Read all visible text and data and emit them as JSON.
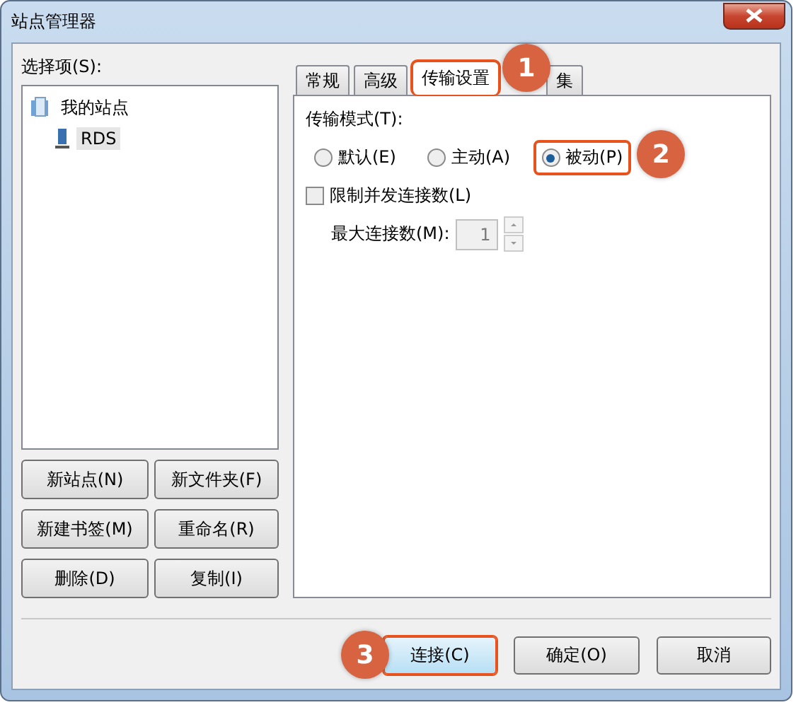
{
  "window": {
    "title": "站点管理器"
  },
  "tree": {
    "label": "选择项(S):",
    "items": [
      {
        "label": "我的站点",
        "selected": false,
        "children": [
          {
            "label": "RDS",
            "selected": true
          }
        ]
      }
    ]
  },
  "site_buttons": [
    "新站点(N)",
    "新文件夹(F)",
    "新建书签(M)",
    "重命名(R)",
    "删除(D)",
    "复制(I)"
  ],
  "tabs": [
    {
      "label": "常规",
      "selected": false
    },
    {
      "label": "高级",
      "selected": false
    },
    {
      "label": "传输设置",
      "selected": true
    },
    {
      "label": "集",
      "selected": false
    }
  ],
  "transfer": {
    "mode_label": "传输模式(T):",
    "modes": [
      {
        "label": "默认(E)",
        "selected": false
      },
      {
        "label": "主动(A)",
        "selected": false
      },
      {
        "label": "被动(P)",
        "selected": true
      }
    ],
    "limit": {
      "label": "限制并发连接数(L)",
      "checked": false
    },
    "max": {
      "label": "最大连接数(M):",
      "value": "1",
      "disabled": true
    }
  },
  "buttons": [
    {
      "label": "连接(C)",
      "default": true
    },
    {
      "label": "确定(O)",
      "default": false
    },
    {
      "label": "取消",
      "default": false
    }
  ],
  "callouts": [
    "1",
    "2",
    "3"
  ]
}
